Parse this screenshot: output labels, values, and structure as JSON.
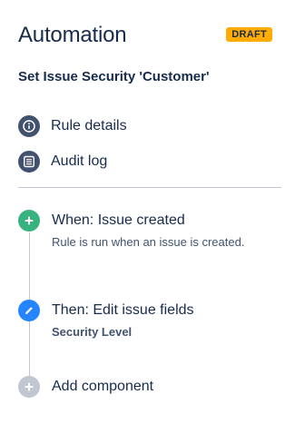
{
  "header": {
    "title": "Automation",
    "badge": "DRAFT"
  },
  "rule": {
    "name": "Set Issue Security 'Customer'"
  },
  "menu": {
    "items": [
      {
        "label": "Rule details",
        "icon": "info-icon"
      },
      {
        "label": "Audit log",
        "icon": "list-icon"
      }
    ]
  },
  "steps": {
    "trigger": {
      "title": "When: Issue created",
      "description": "Rule is run when an issue is created.",
      "icon": "plus-icon",
      "color": "#36b37e"
    },
    "action": {
      "title": "Then: Edit issue fields",
      "description": "Security Level",
      "icon": "pencil-icon",
      "color": "#2684ff"
    },
    "add": {
      "title": "Add component",
      "icon": "plus-icon",
      "color": "#c1c7d0"
    }
  },
  "colors": {
    "badge": "#ffab00",
    "menu_icon_bg": "#42526e",
    "trigger": "#36b37e",
    "action": "#2684ff",
    "add": "#c1c7d0",
    "text": "#172b4d"
  }
}
